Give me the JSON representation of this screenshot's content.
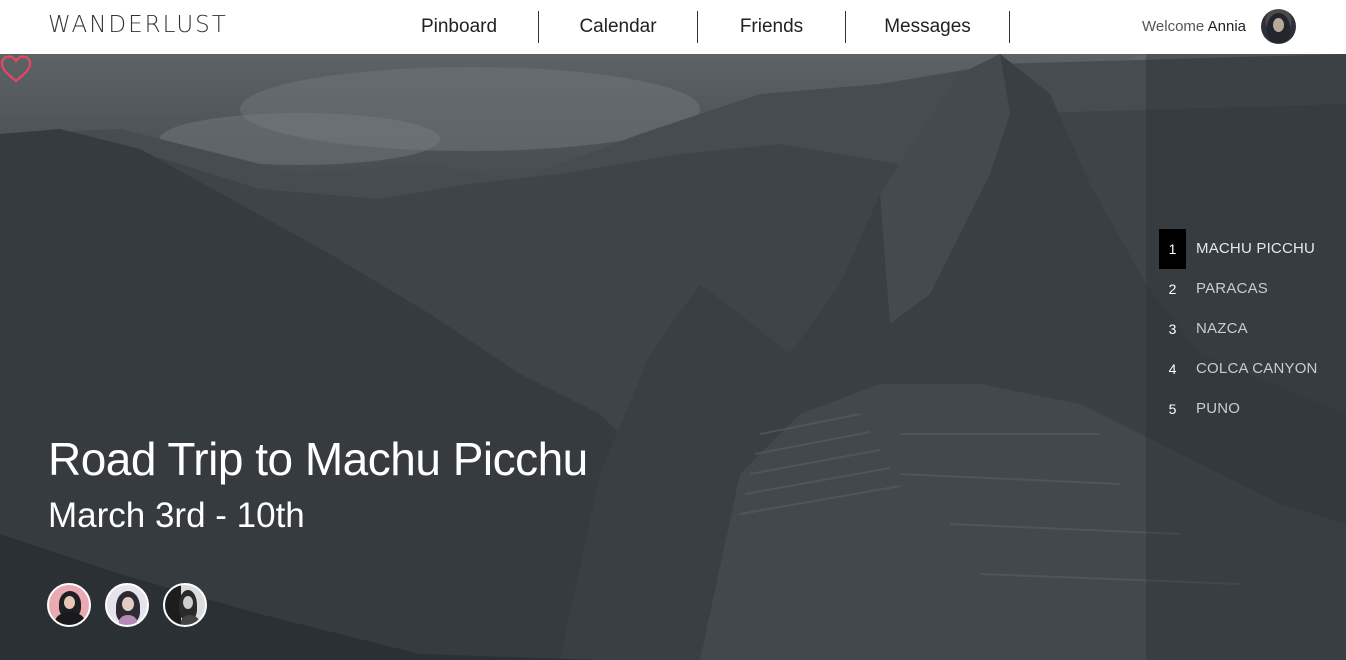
{
  "header": {
    "logo": "WANDERLUST",
    "nav": [
      "Pinboard",
      "Calendar",
      "Friends",
      "Messages"
    ],
    "welcome_prefix": "Welcome",
    "user_name": "Annia"
  },
  "trip": {
    "title": "Road Trip to Machu Picchu",
    "dates": "March 3rd - 10th",
    "favorite_color": "#e8485f"
  },
  "stops": [
    {
      "number": "1",
      "name": "MACHU PICCHU",
      "active": true
    },
    {
      "number": "2",
      "name": "PARACAS",
      "active": false
    },
    {
      "number": "3",
      "name": "NAZCA",
      "active": false
    },
    {
      "number": "4",
      "name": "COLCA CANYON",
      "active": false
    },
    {
      "number": "5",
      "name": "PUNO",
      "active": false
    }
  ]
}
